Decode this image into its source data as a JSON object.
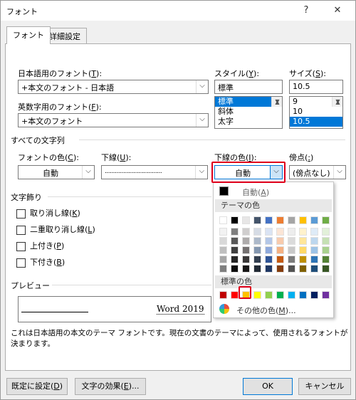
{
  "window": {
    "title": "フォント",
    "help_glyph": "?",
    "close_glyph": "✕"
  },
  "tabs": [
    {
      "label": "フォント"
    },
    {
      "label": "詳細設定"
    }
  ],
  "font": {
    "jp_label": "日本語用のフォント(",
    "jp_accel": "T",
    "jp_value": "+本文のフォント - 日本語",
    "en_label": "英数字用のフォント(",
    "en_accel": "F",
    "en_value": "+本文のフォント",
    "style_label": "スタイル(",
    "style_accel": "Y",
    "style_value": "標準",
    "style_list": [
      "標準",
      "斜体",
      "太字"
    ],
    "size_label": "サイズ(",
    "size_accel": "S",
    "size_value": "10.5",
    "size_list": [
      "9",
      "10",
      "10.5"
    ]
  },
  "all_text": {
    "section_label": "すべての文字列",
    "color_label": "フォントの色(",
    "color_accel": "C",
    "color_value": "自動",
    "underline_label": "下線(",
    "underline_accel": "U",
    "underline_value": "..................................",
    "ucolor_label": "下線の色(",
    "ucolor_accel": "I",
    "ucolor_value": "自動",
    "emphasis_label": "傍点(",
    "emphasis_accel": ":",
    "emphasis_value": "(傍点なし)"
  },
  "effects": {
    "section_label": "文字飾り",
    "items": [
      {
        "label": "取り消し線(",
        "accel": "K"
      },
      {
        "label": "二重取り消し線(",
        "accel": "L"
      },
      {
        "label": "上付き(",
        "accel": "P"
      },
      {
        "label": "下付き(",
        "accel": "B"
      }
    ]
  },
  "preview": {
    "section_label": "プレビュー",
    "sample": "Word 2019",
    "note": "これは日本語用の本文のテーマ フォントです。現在の文書のテーマによって、使用されるフォントが決まります。"
  },
  "palette": {
    "auto_label": "自動(",
    "auto_accel": "A",
    "theme_header": "テーマの色",
    "standard_header": "標準の色",
    "more_label": "その他の色(",
    "more_accel": "M",
    "more_suffix": ")...",
    "theme_columns": [
      [
        "#ffffff",
        "#f2f2f2",
        "#d9d9d9",
        "#bfbfbf",
        "#a6a6a6",
        "#7f7f7f"
      ],
      [
        "#000000",
        "#7f7f7f",
        "#595959",
        "#404040",
        "#262626",
        "#0d0d0d"
      ],
      [
        "#e7e6e6",
        "#d0cece",
        "#aeabab",
        "#757171",
        "#3a3838",
        "#171616"
      ],
      [
        "#44546a",
        "#d6dce5",
        "#adb9ca",
        "#8497b0",
        "#333f50",
        "#222a35"
      ],
      [
        "#4472c4",
        "#dae3f3",
        "#b4c7e7",
        "#8faadc",
        "#2f5597",
        "#1f3864"
      ],
      [
        "#ed7d31",
        "#fbe5d6",
        "#f8cbad",
        "#f4b183",
        "#c55a11",
        "#843c0c"
      ],
      [
        "#a5a5a5",
        "#ededed",
        "#dbdbdb",
        "#c9c9c9",
        "#7b7b7b",
        "#525252"
      ],
      [
        "#ffc000",
        "#fff2cc",
        "#ffe699",
        "#ffd966",
        "#bf9000",
        "#7f6000"
      ],
      [
        "#5b9bd5",
        "#deebf7",
        "#bdd7ee",
        "#9dc3e6",
        "#2e75b6",
        "#1f4e79"
      ],
      [
        "#70ad47",
        "#e2f0d9",
        "#c5e0b4",
        "#a9d18e",
        "#548235",
        "#375623"
      ]
    ],
    "standard_colors": [
      "#c00000",
      "#ff0000",
      "#ffc000",
      "#ffff00",
      "#92d050",
      "#00b050",
      "#00b0f0",
      "#0070c0",
      "#002060",
      "#7030a0"
    ]
  },
  "footer": {
    "default_label": "既定に設定(",
    "default_accel": "D",
    "effects_label": "文字の効果(",
    "effects_accel": "E",
    "effects_suffix": ")...",
    "ok_label": "OK",
    "cancel_label": "キャンセル"
  },
  "accent": "#0078d7",
  "highlight_color": "#e0001a"
}
